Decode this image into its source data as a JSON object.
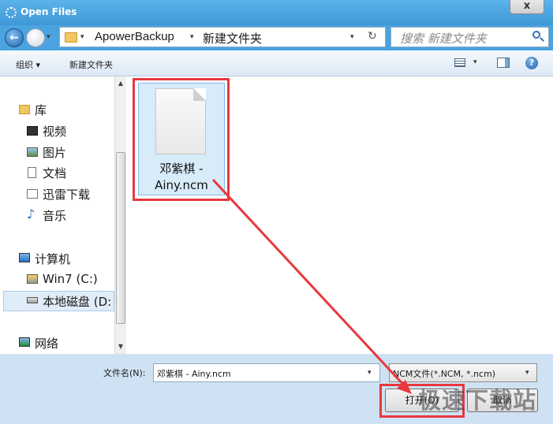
{
  "window": {
    "title": "Open Files",
    "close_glyph": "x"
  },
  "nav": {
    "back_glyph": "←",
    "history_glyph": "▾"
  },
  "address": {
    "segments": [
      "ApowerBackup",
      "新建文件夹"
    ],
    "sep_glyph": "▸",
    "dd_glyph": "▾",
    "refresh_glyph": "↻"
  },
  "search": {
    "placeholder": "搜索 新建文件夹"
  },
  "commandbar": {
    "organize": "组织 ▾",
    "new_folder": "新建文件夹",
    "help_glyph": "?",
    "view_dd": "▾"
  },
  "sidebar": {
    "items": [
      {
        "label": "库",
        "icon": "library-icon"
      },
      {
        "label": "视频",
        "icon": "video-icon"
      },
      {
        "label": "图片",
        "icon": "pictures-icon"
      },
      {
        "label": "文档",
        "icon": "documents-icon"
      },
      {
        "label": "迅雷下载",
        "icon": "download-icon"
      },
      {
        "label": "音乐",
        "icon": "music-icon"
      },
      {
        "label": "计算机",
        "icon": "computer-icon"
      },
      {
        "label": "Win7 (C:)",
        "icon": "drive-c-icon"
      },
      {
        "label": "本地磁盘 (D:",
        "icon": "drive-d-icon"
      },
      {
        "label": "网络",
        "icon": "network-icon"
      }
    ],
    "selected": "本地磁盘 (D:"
  },
  "scrollbar": {
    "up": "▲",
    "down": "▼"
  },
  "files": [
    {
      "name_line1": "邓紫棋 -",
      "name_line2": "Ainy.ncm",
      "icon": "document-file-icon",
      "selected": true
    }
  ],
  "filename": {
    "label": "文件名(N):",
    "value": "邓紫棋 - Ainy.ncm",
    "dd_glyph": "▾"
  },
  "filetype": {
    "value": "NCM文件(*.NCM, *.ncm)",
    "dd_glyph": "▾"
  },
  "buttons": {
    "open": "打开(O)",
    "cancel": "取消"
  },
  "watermark": "极速下载站",
  "colors": {
    "annotation": "#e8383d",
    "titlebar": "#4aa3df",
    "selection": "#d7ebf9"
  }
}
